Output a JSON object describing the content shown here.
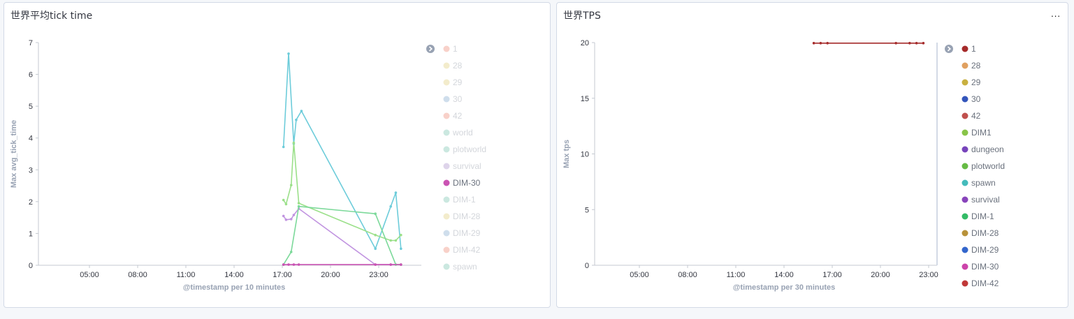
{
  "panels": [
    {
      "title": "世界平均tick time",
      "menu": "",
      "chart_data": {
        "type": "line",
        "ylabel": "Max avg_tick_time",
        "xlabel": "@timestamp per 10 minutes",
        "ylim": [
          0,
          7
        ],
        "yticks": [
          "0",
          "1",
          "2",
          "3",
          "4",
          "5",
          "6",
          "7"
        ],
        "xticks": [
          "05:00",
          "08:00",
          "11:00",
          "14:00",
          "17:00",
          "20:00",
          "23:00"
        ],
        "xlim": [
          2.0,
          27.0
        ],
        "legend_position": "right",
        "legend_toggle_icon": "chevron-right-icon",
        "legend": [
          {
            "name": "1",
            "color": "#e7664c",
            "dim": true
          },
          {
            "name": "28",
            "color": "#d6bf57",
            "dim": true
          },
          {
            "name": "29",
            "color": "#d6bf57",
            "dim": true
          },
          {
            "name": "30",
            "color": "#6092c0",
            "dim": true
          },
          {
            "name": "42",
            "color": "#e7664c",
            "dim": true
          },
          {
            "name": "world",
            "color": "#54b399",
            "dim": true
          },
          {
            "name": "plotworld",
            "color": "#54b399",
            "dim": true
          },
          {
            "name": "survival",
            "color": "#9170b8",
            "dim": true
          },
          {
            "name": "DIM-30",
            "color": "#ca53b3",
            "dim": false
          },
          {
            "name": "DIM-1",
            "color": "#54b399",
            "dim": true
          },
          {
            "name": "DIM-28",
            "color": "#d6bf57",
            "dim": true
          },
          {
            "name": "DIM-29",
            "color": "#6092c0",
            "dim": true
          },
          {
            "name": "DIM-42",
            "color": "#e7664c",
            "dim": true
          },
          {
            "name": "spawn",
            "color": "#54b399",
            "dim": true
          }
        ],
        "series": [
          {
            "name": "world",
            "color": "#6dccda",
            "points": [
              [
                18.0,
                3.72
              ],
              [
                18.33,
                6.65
              ],
              [
                18.67,
                3.82
              ],
              [
                18.83,
                4.57
              ],
              [
                19.17,
                4.85
              ],
              [
                24.0,
                0.52
              ],
              [
                25.0,
                1.85
              ],
              [
                25.33,
                2.28
              ],
              [
                25.67,
                0.52
              ]
            ]
          },
          {
            "name": "plotworld",
            "color": "#9be08a",
            "points": [
              [
                18.0,
                2.05
              ],
              [
                18.17,
                1.92
              ],
              [
                18.5,
                2.52
              ],
              [
                18.67,
                3.85
              ],
              [
                19.0,
                1.95
              ],
              [
                24.0,
                0.95
              ],
              [
                25.0,
                0.78
              ],
              [
                25.33,
                0.78
              ],
              [
                25.67,
                0.95
              ]
            ]
          },
          {
            "name": "survival",
            "color": "#c194e0",
            "points": [
              [
                18.0,
                1.55
              ],
              [
                18.17,
                1.43
              ],
              [
                18.5,
                1.45
              ],
              [
                18.67,
                1.58
              ],
              [
                19.0,
                1.78
              ],
              [
                24.0,
                0.02
              ],
              [
                25.0,
                0.02
              ],
              [
                25.67,
                0.02
              ]
            ]
          },
          {
            "name": "DIM-1",
            "color": "#7cd99a",
            "points": [
              [
                18.0,
                0.02
              ],
              [
                18.5,
                0.42
              ],
              [
                19.0,
                1.85
              ],
              [
                24.0,
                1.62
              ],
              [
                25.33,
                0.02
              ],
              [
                25.67,
                0.02
              ]
            ]
          },
          {
            "name": "DIM-30",
            "color": "#ca53b3",
            "points": [
              [
                18.0,
                0.02
              ],
              [
                18.33,
                0.02
              ],
              [
                18.67,
                0.02
              ],
              [
                19.0,
                0.02
              ],
              [
                24.0,
                0.02
              ],
              [
                25.0,
                0.02
              ],
              [
                25.67,
                0.02
              ]
            ]
          }
        ]
      }
    },
    {
      "title": "世界TPS",
      "menu": "...",
      "chart_data": {
        "type": "line",
        "ylabel": "Max tps",
        "xlabel": "@timestamp per 30 minutes",
        "ylim": [
          0,
          20
        ],
        "yticks": [
          "0",
          "5",
          "10",
          "15",
          "20"
        ],
        "xticks": [
          "05:00",
          "08:00",
          "11:00",
          "14:00",
          "17:00",
          "20:00",
          "23:00"
        ],
        "xlim": [
          2.0,
          27.0
        ],
        "legend_position": "right",
        "legend_toggle_icon": "chevron-right-icon",
        "legend": [
          {
            "name": "1",
            "color": "#a52a2a",
            "dim": false
          },
          {
            "name": "28",
            "color": "#e0a060",
            "dim": false
          },
          {
            "name": "29",
            "color": "#c8b040",
            "dim": false
          },
          {
            "name": "30",
            "color": "#3355bb",
            "dim": false
          },
          {
            "name": "42",
            "color": "#c0504d",
            "dim": false
          },
          {
            "name": "DIM1",
            "color": "#88c448",
            "dim": false
          },
          {
            "name": "dungeon",
            "color": "#7744bb",
            "dim": false
          },
          {
            "name": "plotworld",
            "color": "#66bb44",
            "dim": false
          },
          {
            "name": "spawn",
            "color": "#44bbbb",
            "dim": false
          },
          {
            "name": "survival",
            "color": "#8844bb",
            "dim": false
          },
          {
            "name": "DIM-1",
            "color": "#33bb66",
            "dim": false
          },
          {
            "name": "DIM-28",
            "color": "#b8923a",
            "dim": false
          },
          {
            "name": "DIM-29",
            "color": "#3366cc",
            "dim": false
          },
          {
            "name": "DIM-30",
            "color": "#cc44aa",
            "dim": false
          },
          {
            "name": "DIM-42",
            "color": "#c03838",
            "dim": false
          }
        ],
        "series": [
          {
            "name": "1",
            "color": "#a52a2a",
            "points": [
              [
                18.0,
                19.95
              ],
              [
                18.5,
                19.95
              ],
              [
                19.0,
                19.95
              ],
              [
                24.0,
                19.95
              ],
              [
                25.0,
                19.95
              ],
              [
                25.5,
                19.95
              ],
              [
                26.0,
                19.95
              ]
            ]
          }
        ]
      }
    }
  ]
}
